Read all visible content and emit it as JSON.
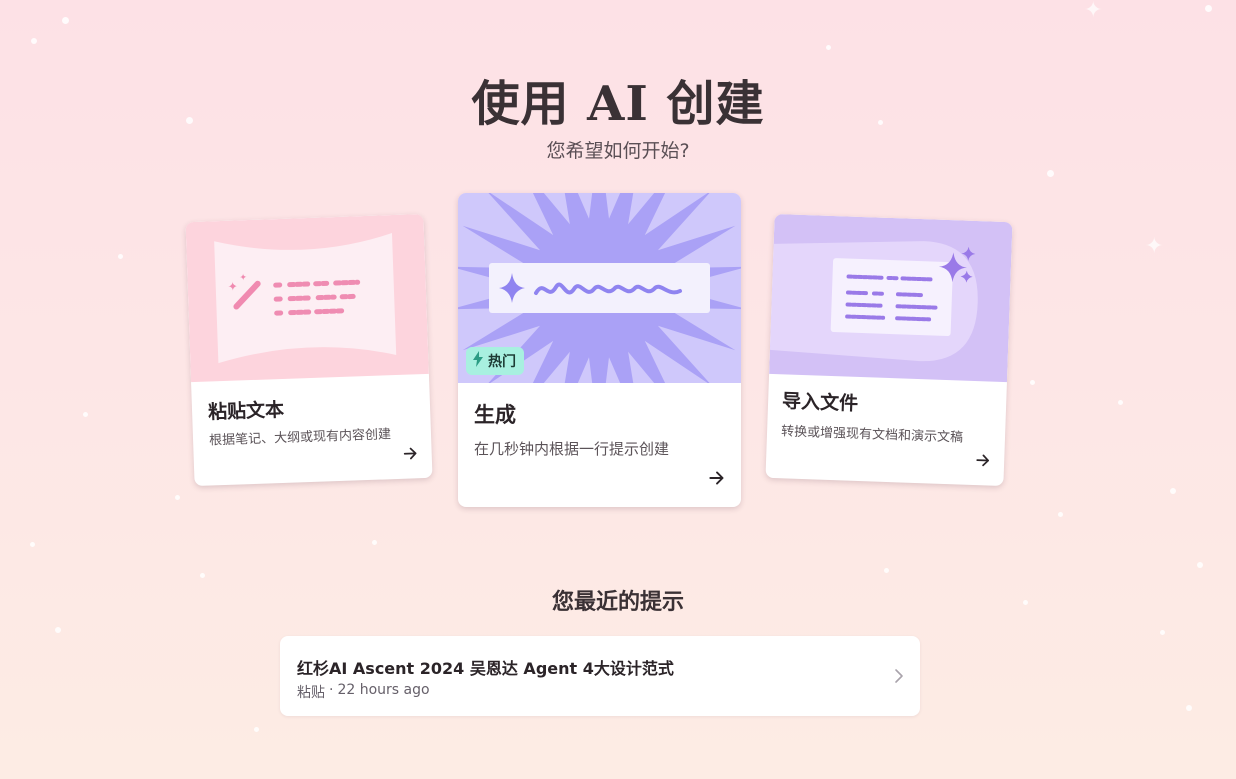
{
  "header": {
    "title": "使用 AI 创建",
    "subtitle": "您希望如何开始?"
  },
  "cards": [
    {
      "id": "paste",
      "label": "粘贴文本",
      "description": "根据笔记、大纲或现有内容创建",
      "icon": "magic-wand-icon",
      "accent": "#f08ab0"
    },
    {
      "id": "generate",
      "label": "生成",
      "description": "在几秒钟内根据一行提示创建",
      "badge": "热门",
      "badge_icon": "lightning-icon",
      "accent": "#8f84f0"
    },
    {
      "id": "import",
      "label": "导入文件",
      "description": "转换或增强现有文档和演示文稿",
      "icon": "sparkles-icon",
      "accent": "#9a7ae8"
    }
  ],
  "recent": {
    "heading": "您最近的提示",
    "items": [
      {
        "title": "红杉AI Ascent 2024 吴恩达 Agent 4大设计范式",
        "source": "粘贴",
        "separator": "·",
        "time": "22 hours ago"
      }
    ]
  },
  "colors": {
    "background_top": "#fde1e6",
    "background_bottom": "#fdece4",
    "badge_bg": "#a8f0e0",
    "generate_illus_bg": "#cfc8fb"
  }
}
